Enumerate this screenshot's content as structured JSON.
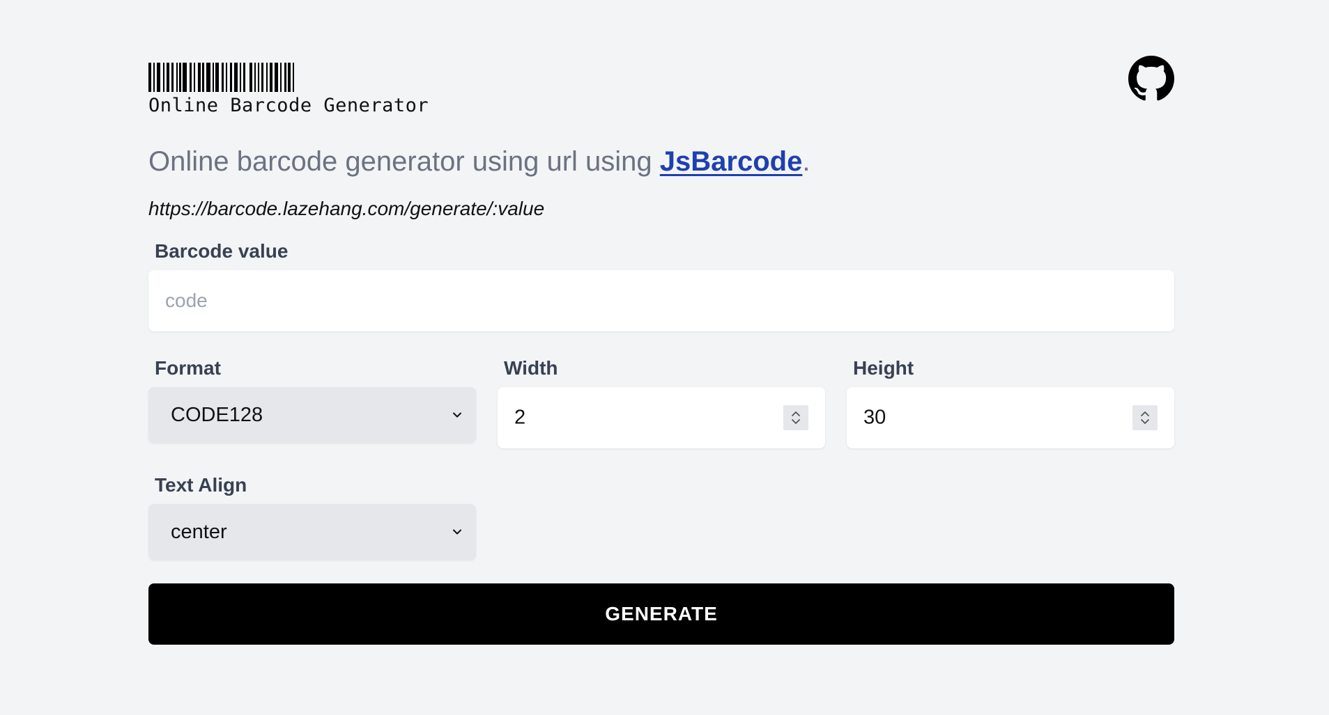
{
  "header": {
    "logo_text": "Online Barcode Generator",
    "github_icon": "github-icon"
  },
  "intro": {
    "headline_prefix": "Online barcode generator using url using ",
    "headline_link": "JsBarcode",
    "headline_suffix": ".",
    "url_pattern": "https://barcode.lazehang.com/generate/:value"
  },
  "form": {
    "barcode_value": {
      "label": "Barcode value",
      "placeholder": "code",
      "value": ""
    },
    "format": {
      "label": "Format",
      "selected": "CODE128"
    },
    "width": {
      "label": "Width",
      "value": "2"
    },
    "height": {
      "label": "Height",
      "value": "30"
    },
    "text_align": {
      "label": "Text Align",
      "selected": "center"
    },
    "generate_label": "GENERATE"
  },
  "colors": {
    "background": "#f3f4f6",
    "link": "#1e40af",
    "button": "#000000",
    "select_bg": "#e5e7eb"
  }
}
